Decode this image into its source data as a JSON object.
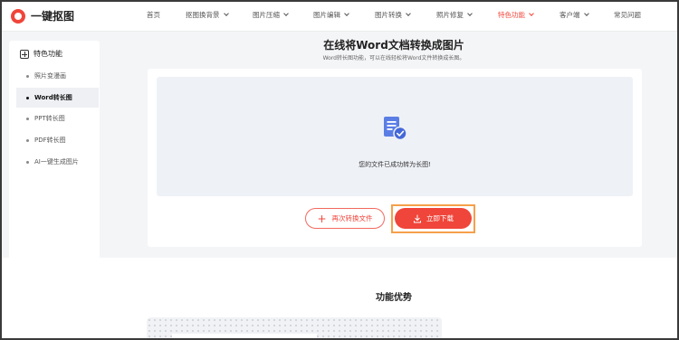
{
  "logo": {
    "text": "一键抠图"
  },
  "nav": {
    "items": [
      {
        "label": "首页",
        "dropdown": false,
        "active": false
      },
      {
        "label": "抠图换背景",
        "dropdown": true,
        "active": false
      },
      {
        "label": "图片压缩",
        "dropdown": true,
        "active": false
      },
      {
        "label": "图片编辑",
        "dropdown": true,
        "active": false
      },
      {
        "label": "图片转换",
        "dropdown": true,
        "active": false
      },
      {
        "label": "照片修复",
        "dropdown": true,
        "active": false
      },
      {
        "label": "特色功能",
        "dropdown": true,
        "active": true
      },
      {
        "label": "客户端",
        "dropdown": true,
        "active": false
      },
      {
        "label": "常见问题",
        "dropdown": false,
        "active": false
      }
    ]
  },
  "sidebar": {
    "heading": "特色功能",
    "items": [
      {
        "label": "照片变漫画",
        "active": false
      },
      {
        "label": "Word转长图",
        "active": true
      },
      {
        "label": "PPT转长图",
        "active": false
      },
      {
        "label": "PDF转长图",
        "active": false
      },
      {
        "label": "AI一键生成图片",
        "active": false
      }
    ]
  },
  "main": {
    "title": "在线将Word文档转换成图片",
    "subtitle": "Word转长图功能，可以在线轻松将Word文件转换成长图。",
    "status": "您的文件已成功转为长图!",
    "convert_again_label": "再次转换文件",
    "download_label": "立即下载",
    "section_title": "功能优势"
  },
  "colors": {
    "accent": "#f0453a",
    "highlight": "#f5a04a"
  }
}
